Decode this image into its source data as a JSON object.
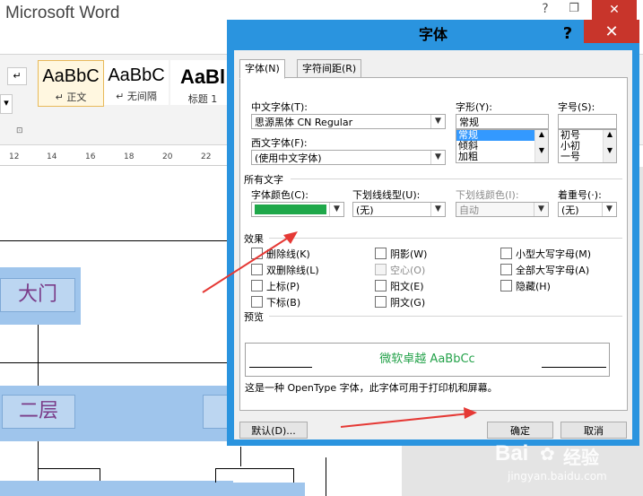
{
  "word": {
    "title": "Microsoft Word",
    "window_controls": {
      "help": "?",
      "minimize": "–",
      "restore": "❐",
      "close": "✕"
    },
    "styles": [
      {
        "sample": "AaBbC",
        "label": "↵ 正文"
      },
      {
        "sample": "AaBbC",
        "label": "↵ 无间隔"
      },
      {
        "sample": "AaBl",
        "label": "标题 1"
      }
    ],
    "ruler": [
      "12",
      "14",
      "16",
      "18",
      "20",
      "22"
    ],
    "flow": {
      "gate": "大门",
      "floor2": "二层"
    }
  },
  "dialog": {
    "title": "字体",
    "help": "?",
    "close": "✕",
    "tabs": [
      "字体(N)",
      "字符间距(R)"
    ],
    "chinese_font": {
      "label": "中文字体(T):",
      "value": "思源黑体 CN Regular"
    },
    "western_font": {
      "label": "西文字体(F):",
      "value": "(使用中文字体)"
    },
    "style": {
      "label": "字形(Y):",
      "value": "常规",
      "options": [
        "常规",
        "倾斜",
        "加粗"
      ]
    },
    "size": {
      "label": "字号(S):",
      "value": "",
      "options": [
        "初号",
        "小初",
        "一号"
      ]
    },
    "all_text": {
      "heading": "所有文字",
      "color": {
        "label": "字体颜色(C):",
        "value_color": "#1fa84a"
      },
      "underline_style": {
        "label": "下划线线型(U):",
        "value": "(无)"
      },
      "underline_color": {
        "label": "下划线颜色(I):",
        "value": "自动"
      },
      "emphasis": {
        "label": "着重号(·):",
        "value": "(无)"
      }
    },
    "effects": {
      "heading": "效果",
      "items": [
        "删除线(K)",
        "阴影(W)",
        "小型大写字母(M)",
        "双删除线(L)",
        "空心(O)",
        "全部大写字母(A)",
        "上标(P)",
        "阳文(E)",
        "隐藏(H)",
        "下标(B)",
        "阴文(G)"
      ]
    },
    "preview": {
      "heading": "预览",
      "text": "微软卓越  AaBbCc",
      "note": "这是一种 OpenType 字体，此字体可用于打印机和屏幕。"
    },
    "buttons": {
      "default": "默认(D)...",
      "ok": "确定",
      "cancel": "取消"
    }
  },
  "watermark": {
    "brand": "Bai",
    "brand2": "经验",
    "url": "jingyan.baidu.com"
  },
  "colors": {
    "dialog_frame": "#2a94df",
    "close_red": "#c8352b",
    "arrow": "#e53935",
    "font_green": "#1fa84a"
  }
}
